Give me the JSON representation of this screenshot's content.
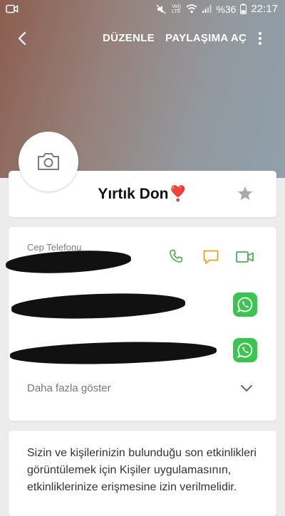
{
  "status_bar": {
    "battery": "%36",
    "time": "22:17",
    "volte": "Vo)) LTE",
    "icons": [
      "video-notification-icon",
      "mute-icon",
      "wifi-icon",
      "signal-icon",
      "battery-icon"
    ]
  },
  "app_bar": {
    "edit_label": "DÜZENLE",
    "share_label": "PAYLAŞIMA AÇ",
    "back_icon": "back-arrow-icon",
    "more_icon": "more-vert-icon"
  },
  "contact": {
    "name": "Yırtık Don❣️",
    "avatar_icon": "camera-icon",
    "favorite_icon": "star-icon"
  },
  "phone_section": {
    "label": "Cep Telefonu",
    "actions": [
      "call-icon",
      "message-icon",
      "video-call-icon"
    ],
    "whatsapp_icon": "whatsapp-icon",
    "show_more_label": "Daha fazla göster"
  },
  "info": {
    "text": "Sizin ve kişilerinizin bulunduğu son etkinlikleri görüntülemek için Kişiler uygulamasının, etkinliklerinize erişmesine izin verilmelidir."
  },
  "colors": {
    "green": "#4caf50",
    "orange": "#f0a01e",
    "whatsapp": "#3cc351"
  }
}
